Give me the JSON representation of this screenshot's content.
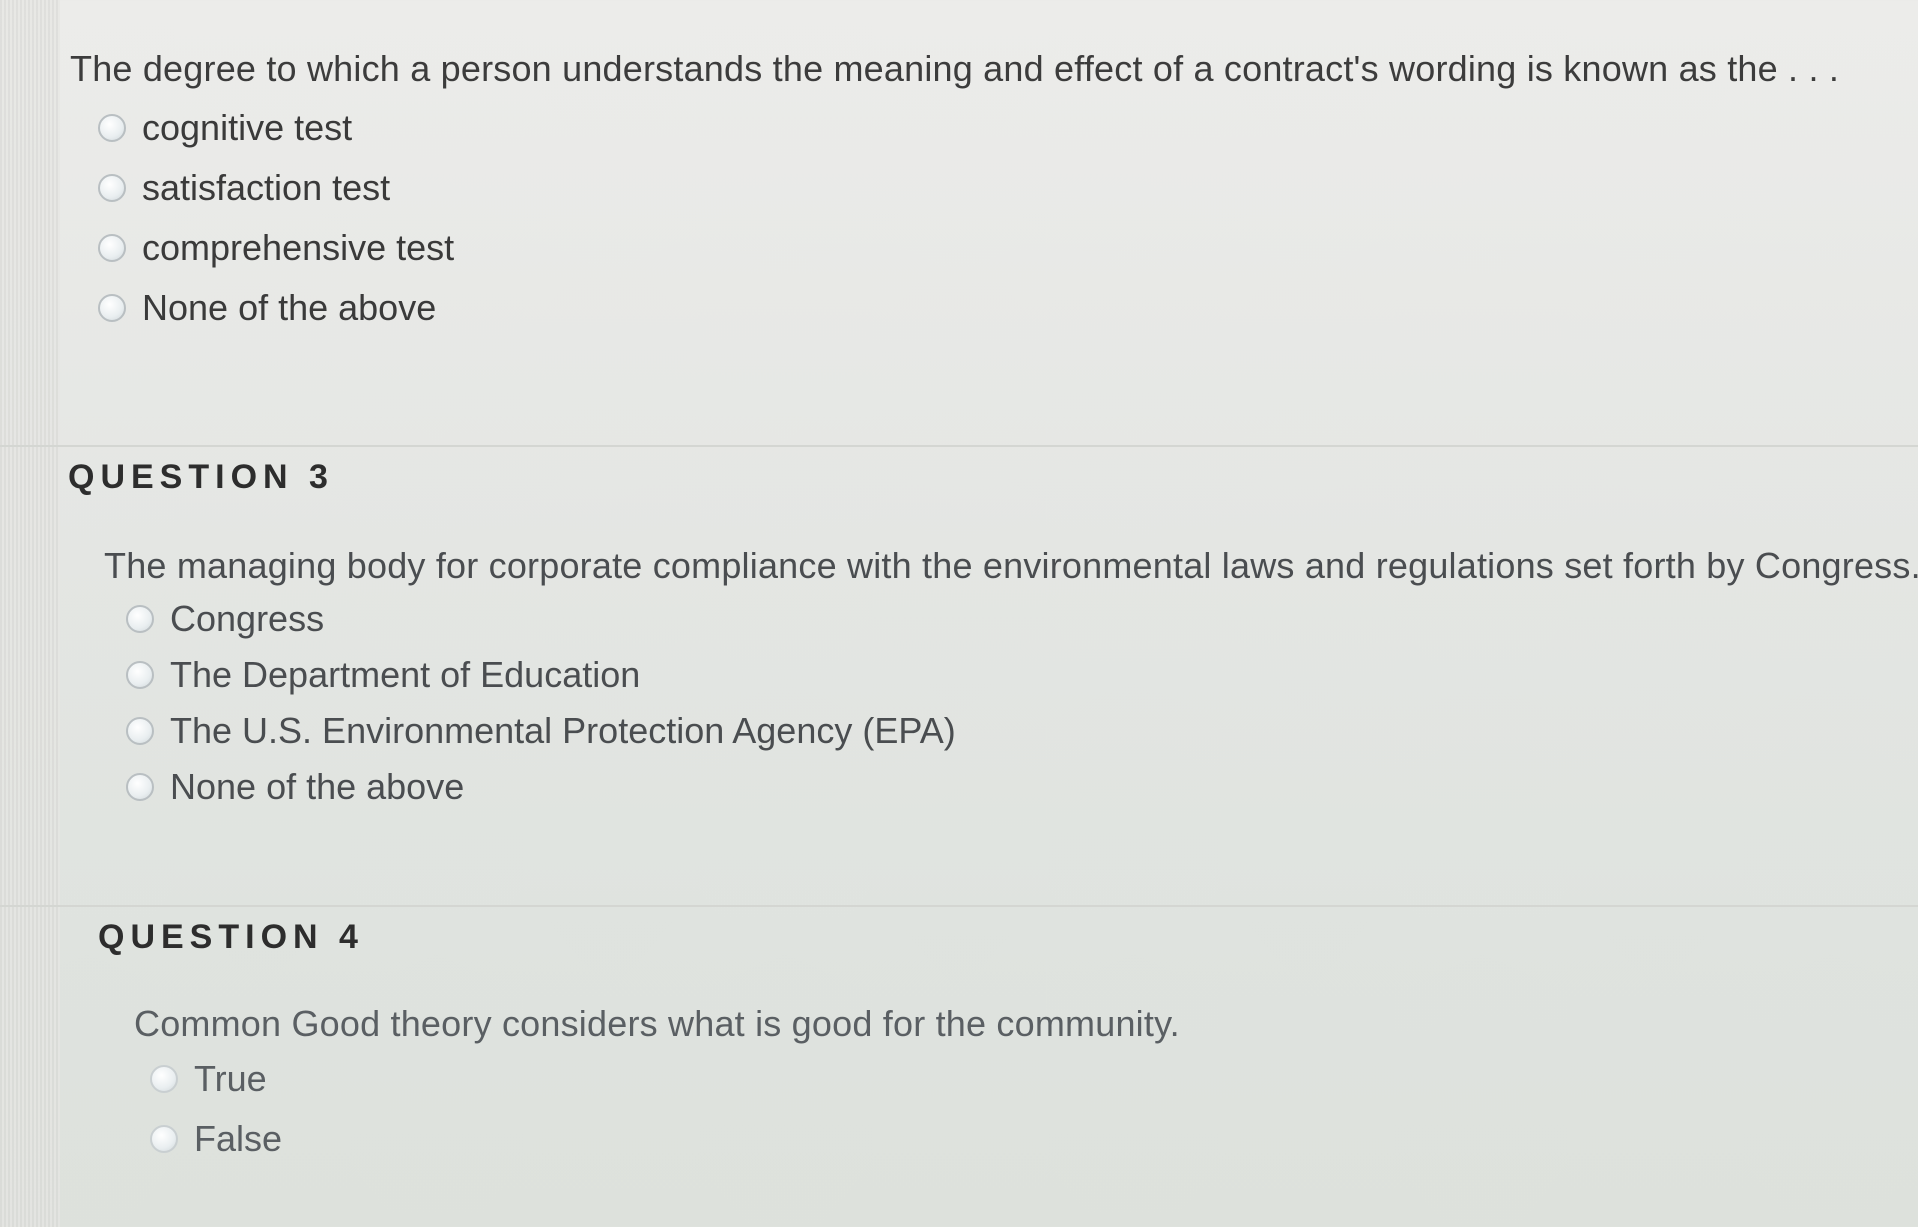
{
  "question2": {
    "text": "The degree to which a person understands the meaning and effect of a contract's wording is known as the . . .",
    "options": [
      {
        "label": "cognitive test"
      },
      {
        "label": "satisfaction test"
      },
      {
        "label": "comprehensive test"
      },
      {
        "label": "None of the above"
      }
    ]
  },
  "question3": {
    "heading": "QUESTION 3",
    "text": "The managing body for corporate compliance with the environmental laws and regulations set forth by Congress.",
    "options": [
      {
        "label": "Congress"
      },
      {
        "label": "The Department of Education"
      },
      {
        "label": "The U.S. Environmental Protection Agency (EPA)"
      },
      {
        "label": "None of the above"
      }
    ]
  },
  "question4": {
    "heading": "QUESTION 4",
    "text": "Common Good theory considers what is good for the community.",
    "options": [
      {
        "label": "True"
      },
      {
        "label": "False"
      }
    ]
  }
}
